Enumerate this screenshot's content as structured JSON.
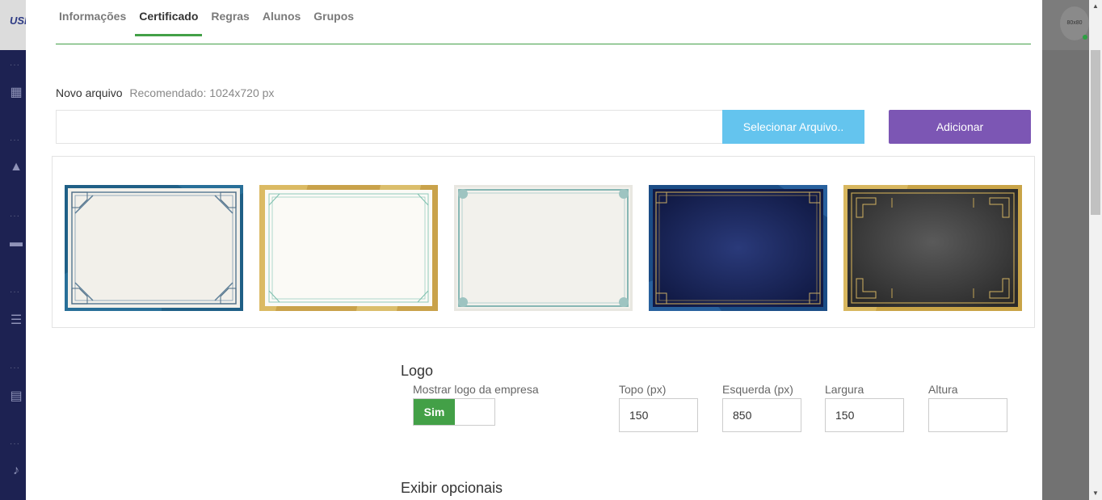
{
  "app": {
    "logo_text": "USE",
    "avatar_text": "80x80"
  },
  "tabs": [
    {
      "label": "Informações"
    },
    {
      "label": "Certificado"
    },
    {
      "label": "Regras"
    },
    {
      "label": "Alunos"
    },
    {
      "label": "Grupos"
    }
  ],
  "upload": {
    "label": "Novo arquivo",
    "hint": "Recomendado: 1024x720 px",
    "select_label": "Selecionar Arquivo..",
    "add_label": "Adicionar"
  },
  "templates": [
    {
      "name": "Blue ornate frame",
      "bg": "#1f5f86"
    },
    {
      "name": "Gold and mint frame",
      "bg": "#c9a24a"
    },
    {
      "name": "Teal scroll frame",
      "bg": "#f2f1ec"
    },
    {
      "name": "Navy gold frame",
      "bg": "#12306a"
    },
    {
      "name": "Dark art deco frame",
      "bg": "#c9a447"
    }
  ],
  "logo": {
    "title": "Logo",
    "show_label": "Mostrar logo da empresa",
    "toggle_on": "Sim",
    "top_label": "Topo (px)",
    "top_value": "150",
    "left_label": "Esquerda (px)",
    "left_value": "850",
    "width_label": "Largura",
    "width_value": "150",
    "height_label": "Altura",
    "height_value": ""
  },
  "optionals": {
    "title": "Exibir opcionais"
  },
  "colors": {
    "accent_green": "#43a047",
    "select_blue": "#64c4ee",
    "add_purple": "#7c56b4"
  }
}
